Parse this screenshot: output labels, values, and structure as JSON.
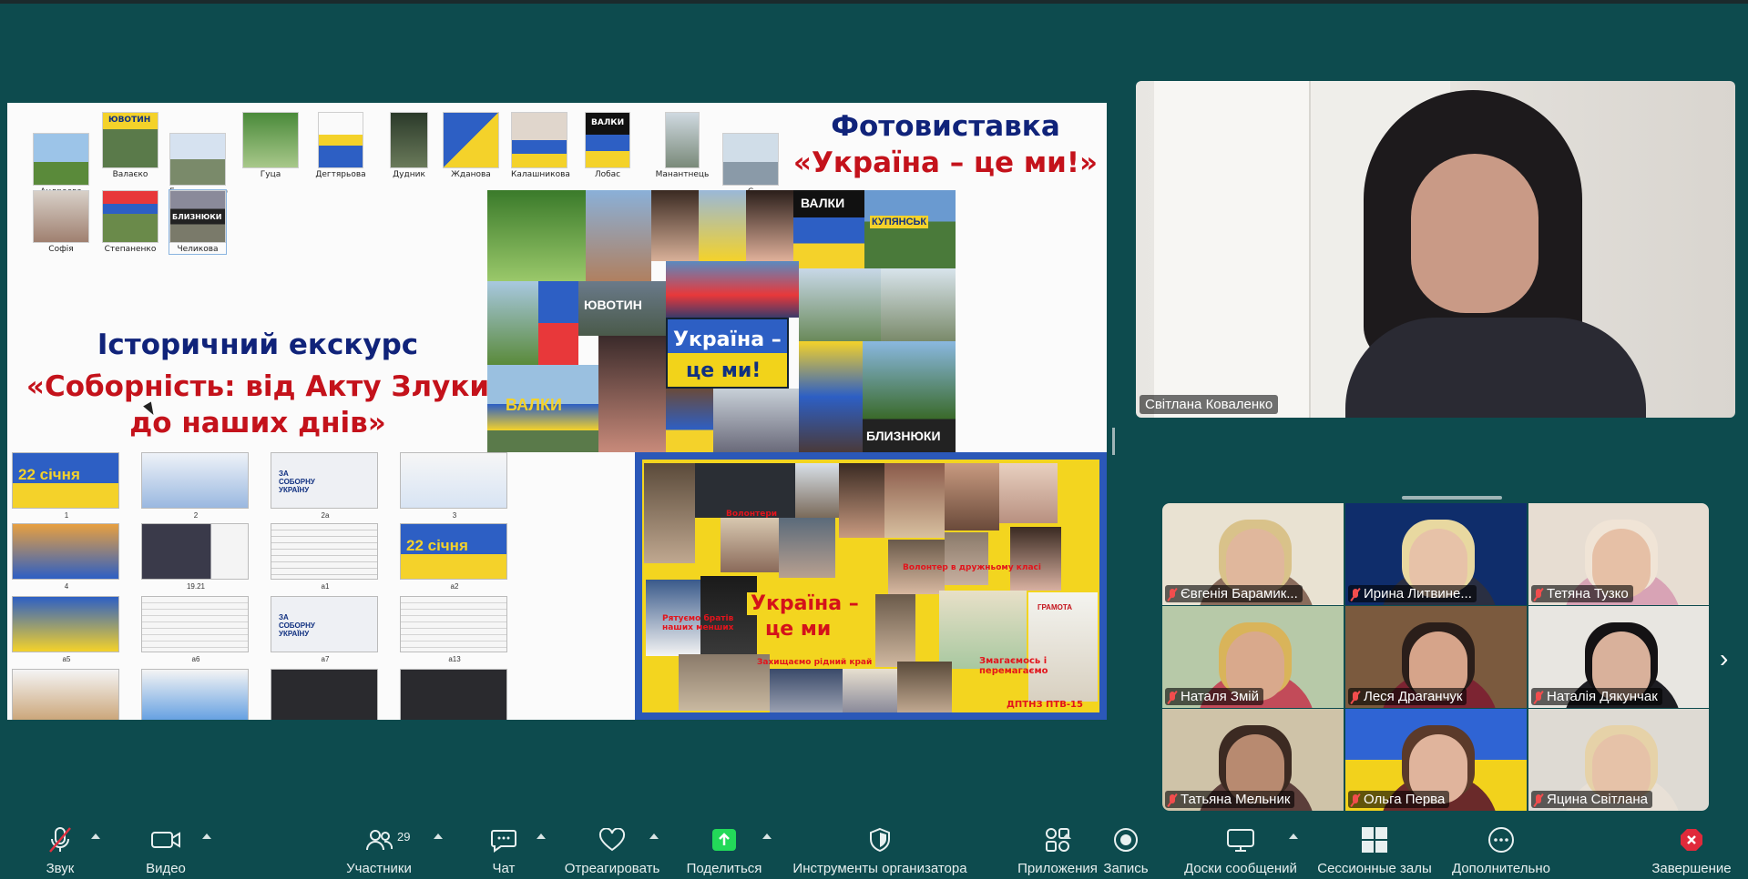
{
  "shared_screen": {
    "photo_thumbs": [
      {
        "caption": "Андреева"
      },
      {
        "caption": "Валаєко"
      },
      {
        "caption": "Головащенко"
      },
      {
        "caption": "Гуца"
      },
      {
        "caption": "Дегтярьова"
      },
      {
        "caption": "Дудник"
      },
      {
        "caption": "Жданова"
      },
      {
        "caption": "Калашникова"
      },
      {
        "caption": "Лобас"
      },
      {
        "caption": "Манантнець"
      },
      {
        "caption": "С"
      },
      {
        "caption": "Софія"
      },
      {
        "caption": "Степаненко"
      },
      {
        "caption": "Челикова"
      }
    ],
    "thumb_overlay_text": "ЮВОТИН",
    "thumb_overlay_text2": "ВАЛКИ",
    "thumb_overlay_text3": "БЛИЗНЮКИ",
    "exhibit_title_line1": "Фотовиставка",
    "exhibit_title_line2": "«Україна – це ми!»",
    "history_title_line1": "Історичний екскурс",
    "history_title_line2": "«Соборність:  від Акту Злуки",
    "history_title_line3": "до наших днів»",
    "collage1": {
      "flag_text1": "Україна –",
      "flag_text2": "це ми!",
      "sign_valky": "ВАЛКИ",
      "sign_kupiansk": "КУПЯНСЬК",
      "sign_yuvotyn": "ЮВОТИН",
      "sign_blyzniuky": "БЛИЗНЮКИ",
      "sign_valky2": "ВАЛКИ"
    },
    "slides": [
      {
        "caption": "1",
        "text": "22 січня"
      },
      {
        "caption": "2",
        "text": ""
      },
      {
        "caption": "2а",
        "text": "ЗА СОБОРНУ УКРАЇНУ"
      },
      {
        "caption": "3",
        "text": ""
      },
      {
        "caption": "4",
        "text": ""
      },
      {
        "caption": "19.21",
        "text": ""
      },
      {
        "caption": "а1",
        "text": ""
      },
      {
        "caption": "а2",
        "text": "22 січня"
      },
      {
        "caption": "а5",
        "text": ""
      },
      {
        "caption": "а6",
        "text": ""
      },
      {
        "caption": "а7",
        "text": "ЗА СОБОРНУ УКРАЇНУ"
      },
      {
        "caption": "а13",
        "text": ""
      },
      {
        "caption": "",
        "text": ""
      },
      {
        "caption": "",
        "text": ""
      },
      {
        "caption": "",
        "text": ""
      },
      {
        "caption": "",
        "text": ""
      }
    ],
    "collage2": {
      "title1": "Україна –",
      "title2": "це ми",
      "caption_volunteers": "Волонтери",
      "caption_volunteer2": "Волонтер в дружньому класі",
      "caption_rescue": "Рятуємо братів наших менших",
      "caption_defend": "Захищаємо рідний край",
      "caption_fight": "Змагаємось і перемагаємо",
      "caption_gramota": "ГРАМОТА",
      "footer": "ДПТНЗ ПТВ-15"
    }
  },
  "speaker": {
    "name": "Світлана Коваленко"
  },
  "gallery": [
    {
      "name": "Євгенія Барамик...",
      "bg": "#e9e2d2",
      "skin": "#e0b79c",
      "cloth": "#8a6c5c",
      "hair": "#d9c28a"
    },
    {
      "name": "Ирина Литвине...",
      "bg": "#0f2d6b",
      "skin": "#e7c2a8",
      "cloth": "#2a2f42",
      "hair": "#e8d8a0"
    },
    {
      "name": "Тетяна Тузко",
      "bg": "#e7ddd2",
      "skin": "#e6c0a6",
      "cloth": "#d8a3b5",
      "hair": "#f0e4d6"
    },
    {
      "name": "Наталя Змій",
      "bg": "#b7c9a8",
      "skin": "#d9a98c",
      "cloth": "#c24b59",
      "hair": "#d9b45a"
    },
    {
      "name": "Леся Драганчук",
      "bg": "#7b5a3e",
      "skin": "#d6a48a",
      "cloth": "#7c2432",
      "hair": "#2a1e1a"
    },
    {
      "name": "Наталія Дякунчак",
      "bg": "#e8e6e1",
      "skin": "#d9b19b",
      "cloth": "#1d1d22",
      "hair": "#141214"
    },
    {
      "name": "Татьяна Мельник",
      "bg": "#cfc3a8",
      "skin": "#b88a70",
      "cloth": "#5b3e3a",
      "hair": "#3c2a22"
    },
    {
      "name": "Ольга Перва",
      "bg": "#3e6ed1",
      "skin": "#e0b49c",
      "cloth": "#6a2a2a",
      "hair": "#5b3a2a"
    },
    {
      "name": "Яцина Світлана",
      "bg": "#dedad3",
      "skin": "#e6c2a8",
      "cloth": "#e8e0d6",
      "hair": "#e6d2a8"
    }
  ],
  "toolbar": {
    "audio": "Звук",
    "video": "Видео",
    "participants": "Участники",
    "participants_count": "29",
    "chat": "Чат",
    "react": "Отреагировать",
    "share": "Поделиться",
    "host_tools": "Инструменты организатора",
    "apps": "Приложения",
    "record": "Запись",
    "whiteboards": "Доски сообщений",
    "breakout": "Сессионные залы",
    "more": "Дополнительно",
    "end": "Завершение",
    "share_color": "#23d959",
    "end_color": "#e02a3b"
  }
}
